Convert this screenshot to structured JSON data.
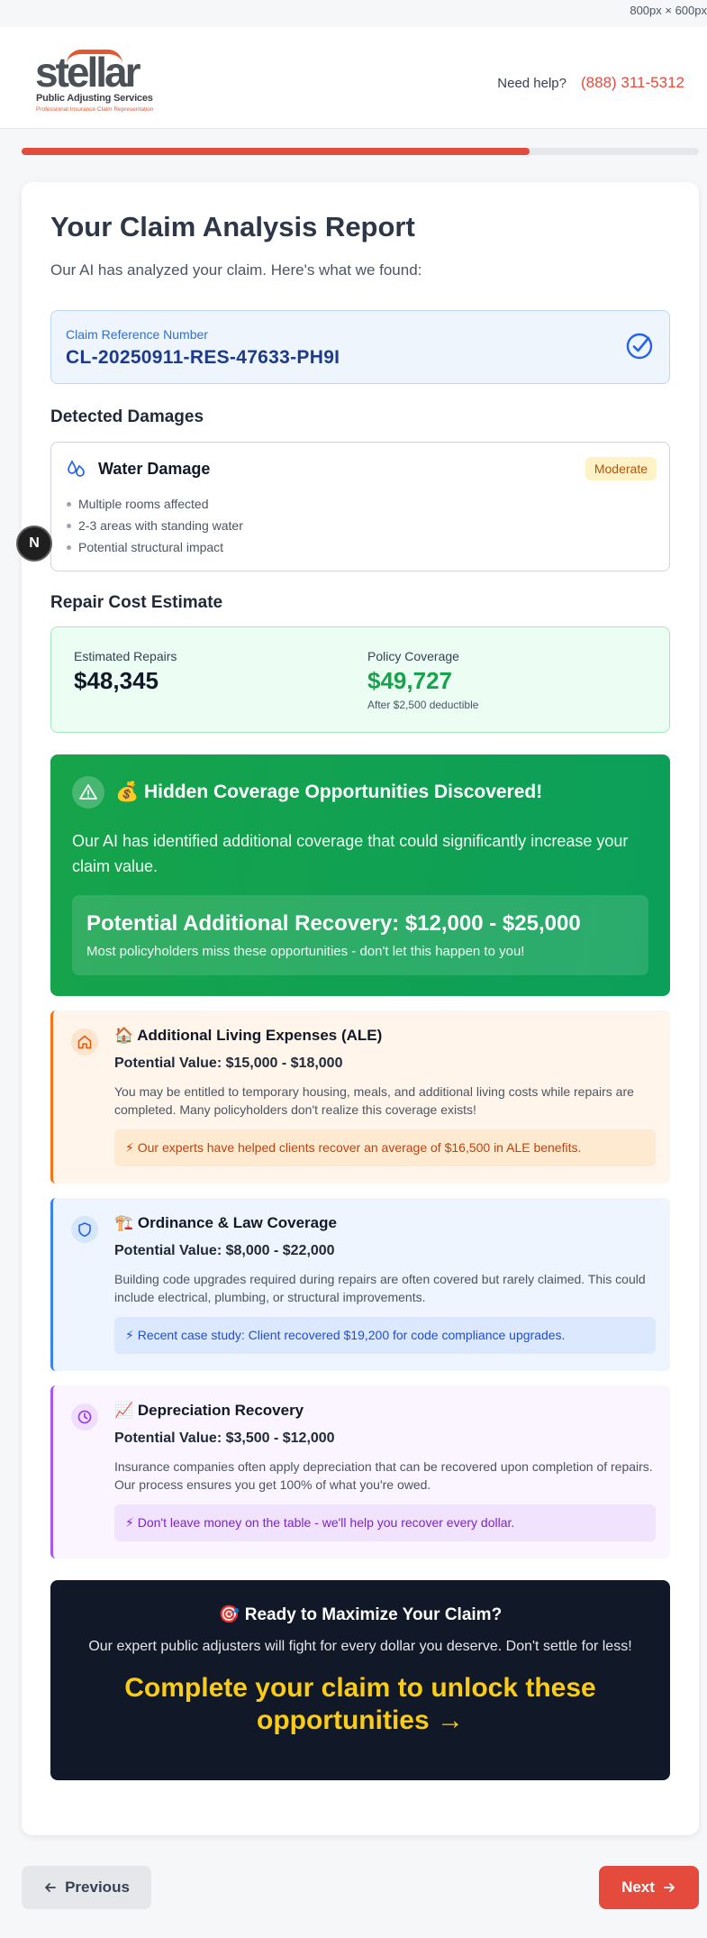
{
  "viewport_label": "800px × 600px",
  "header": {
    "logo": {
      "word": "stellar",
      "subtitle": "Public Adjusting Services",
      "tagline": "Professional Insurance Claim Representation"
    },
    "help_text": "Need help?",
    "phone": "(888) 311-5312"
  },
  "progress": {
    "percent": 75
  },
  "report": {
    "title": "Your Claim Analysis Report",
    "subtitle": "Our AI has analyzed your claim. Here's what we found:",
    "reference": {
      "label": "Claim Reference Number",
      "value": "CL-20250911-RES-47633-PH9I"
    }
  },
  "damages": {
    "heading": "Detected Damages",
    "items": [
      {
        "name": "Water Damage",
        "severity": "Moderate",
        "icon": "water-drops-icon",
        "details": [
          "Multiple rooms affected",
          "2-3 areas with standing water",
          "Potential structural impact"
        ]
      }
    ]
  },
  "estimate": {
    "heading": "Repair Cost Estimate",
    "repairs_label": "Estimated Repairs",
    "repairs_value": "$48,345",
    "coverage_label": "Policy Coverage",
    "coverage_value": "$49,727",
    "coverage_note": "After $2,500 deductible"
  },
  "hidden_coverage": {
    "title": "💰 Hidden Coverage Opportunities Discovered!",
    "description": "Our AI has identified additional coverage that could significantly increase your claim value.",
    "recovery_title": "Potential Additional Recovery: $12,000 - $25,000",
    "recovery_subtitle": "Most policyholders miss these opportunities - don't let this happen to you!"
  },
  "opportunities": [
    {
      "title": "🏠 Additional Living Expenses (ALE)",
      "value": "Potential Value: $15,000 - $18,000",
      "description": "You may be entitled to temporary housing, meals, and additional living costs while repairs are completed. Many policyholders don't realize this coverage exists!",
      "tip": "⚡ Our experts have helped clients recover an average of $16,500 in ALE benefits.",
      "icon": "home-icon",
      "accent": "#f97316"
    },
    {
      "title": "🏗️ Ordinance & Law Coverage",
      "value": "Potential Value: $8,000 - $22,000",
      "description": "Building code upgrades required during repairs are often covered but rarely claimed. This could include electrical, plumbing, or structural improvements.",
      "tip": "⚡ Recent case study: Client recovered $19,200 for code compliance upgrades.",
      "icon": "shield-icon",
      "accent": "#3b82f6"
    },
    {
      "title": "📈 Depreciation Recovery",
      "value": "Potential Value: $3,500 - $12,000",
      "description": "Insurance companies often apply depreciation that can be recovered upon completion of repairs. Our process ensures you get 100% of what you're owed.",
      "tip": "⚡ Don't leave money on the table - we'll help you recover every dollar.",
      "icon": "clock-icon",
      "accent": "#a855f7"
    }
  ],
  "cta": {
    "title": "🎯 Ready to Maximize Your Claim?",
    "description": "Our expert public adjusters will fight for every dollar you deserve. Don't settle for less!",
    "action": "Complete your claim to unlock these opportunities →"
  },
  "nav": {
    "previous": "Previous",
    "next": "Next"
  },
  "overlay": {
    "badge": "N"
  }
}
